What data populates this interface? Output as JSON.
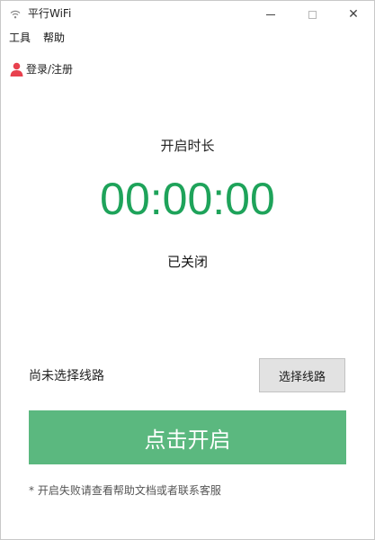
{
  "window": {
    "title": "平行WiFi",
    "icons": {
      "app": "wifi-icon",
      "minimize": "minimize-icon",
      "maximize": "maximize-icon",
      "close": "close-icon"
    },
    "close_glyph": "✕"
  },
  "menu": {
    "items": [
      {
        "label": "工具"
      },
      {
        "label": "帮助"
      }
    ]
  },
  "account": {
    "login_label": "登录/注册",
    "icon": "user-icon"
  },
  "timer": {
    "caption": "开启时长",
    "value": "00:00:00",
    "status": "已关闭"
  },
  "route": {
    "status_text": "尚未选择线路",
    "select_button_label": "选择线路"
  },
  "primary_action": {
    "label": "点击开启"
  },
  "footer": {
    "help_note": "* 开启失败请查看帮助文档或者联系客服"
  },
  "colors": {
    "timer_text": "#1ea35a",
    "primary_button_bg": "#5bb87f",
    "primary_button_text": "#ffffff",
    "secondary_button_bg": "#e2e2e2",
    "user_icon": "#e8414e"
  }
}
